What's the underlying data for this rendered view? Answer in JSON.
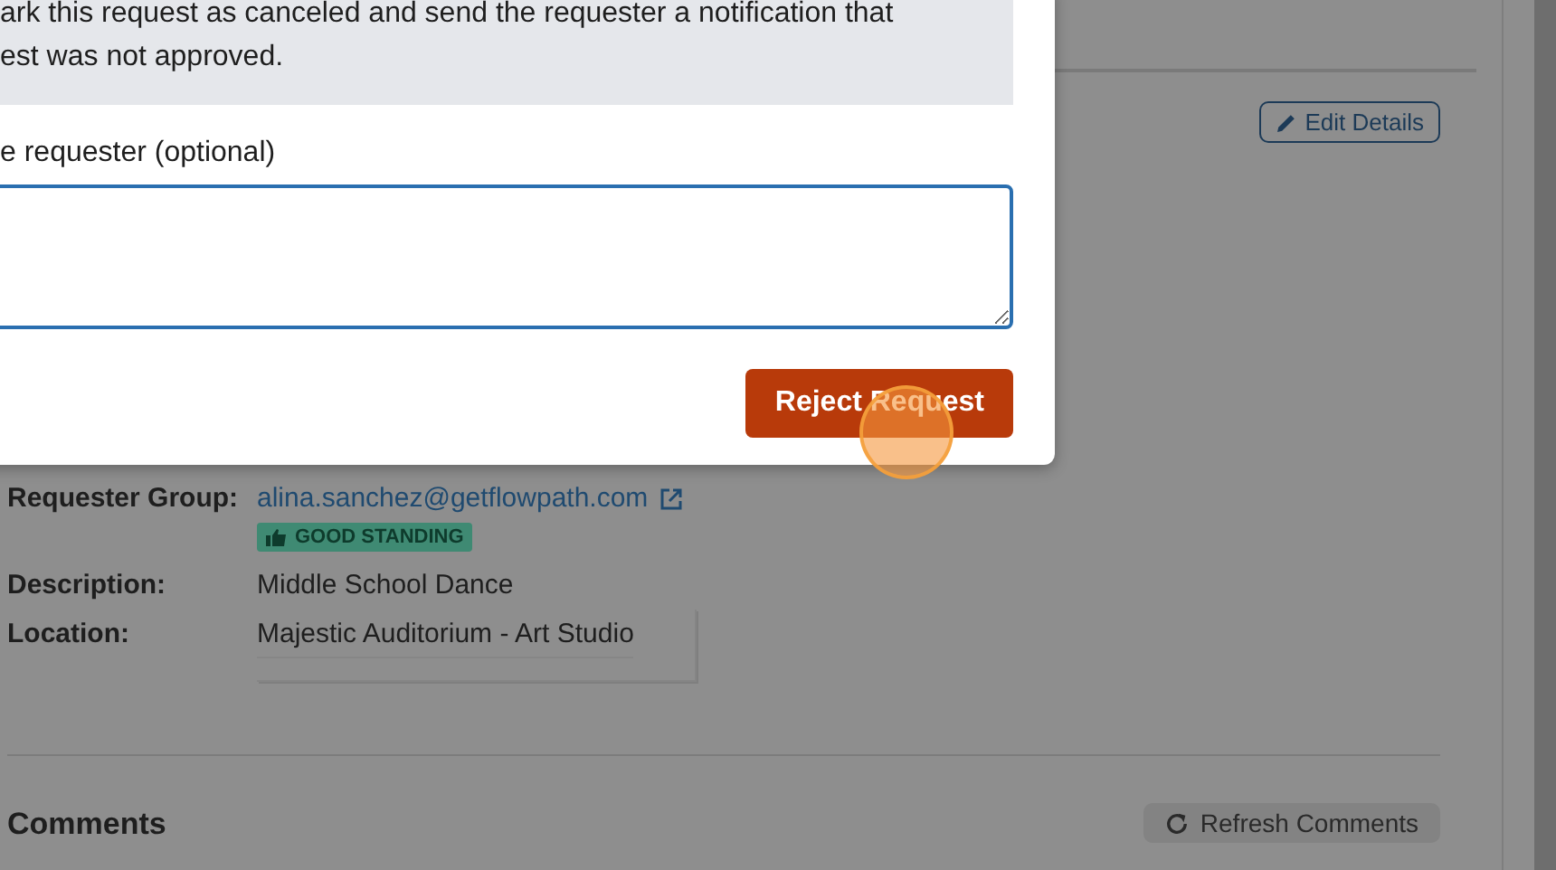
{
  "modal": {
    "notice": [
      "ark this request as canceled and send the requester a notification that",
      "est was not approved."
    ],
    "field_label": "e requester (optional)",
    "submit_button": "Reject Request"
  },
  "page": {
    "edit_button": "Edit Details",
    "details": [
      {
        "label": "Requester Group:",
        "value": "alina.sanchez@getflowpath.com",
        "kind": "link",
        "badge": "GOOD STANDING"
      },
      {
        "label": "Description:",
        "value": "Middle School Dance",
        "kind": "text"
      },
      {
        "label": "Location:",
        "value": "Majestic Auditorium - Art Studio",
        "kind": "boxed"
      }
    ],
    "comments_title": "Comments",
    "refresh_button": "Refresh Comments"
  }
}
